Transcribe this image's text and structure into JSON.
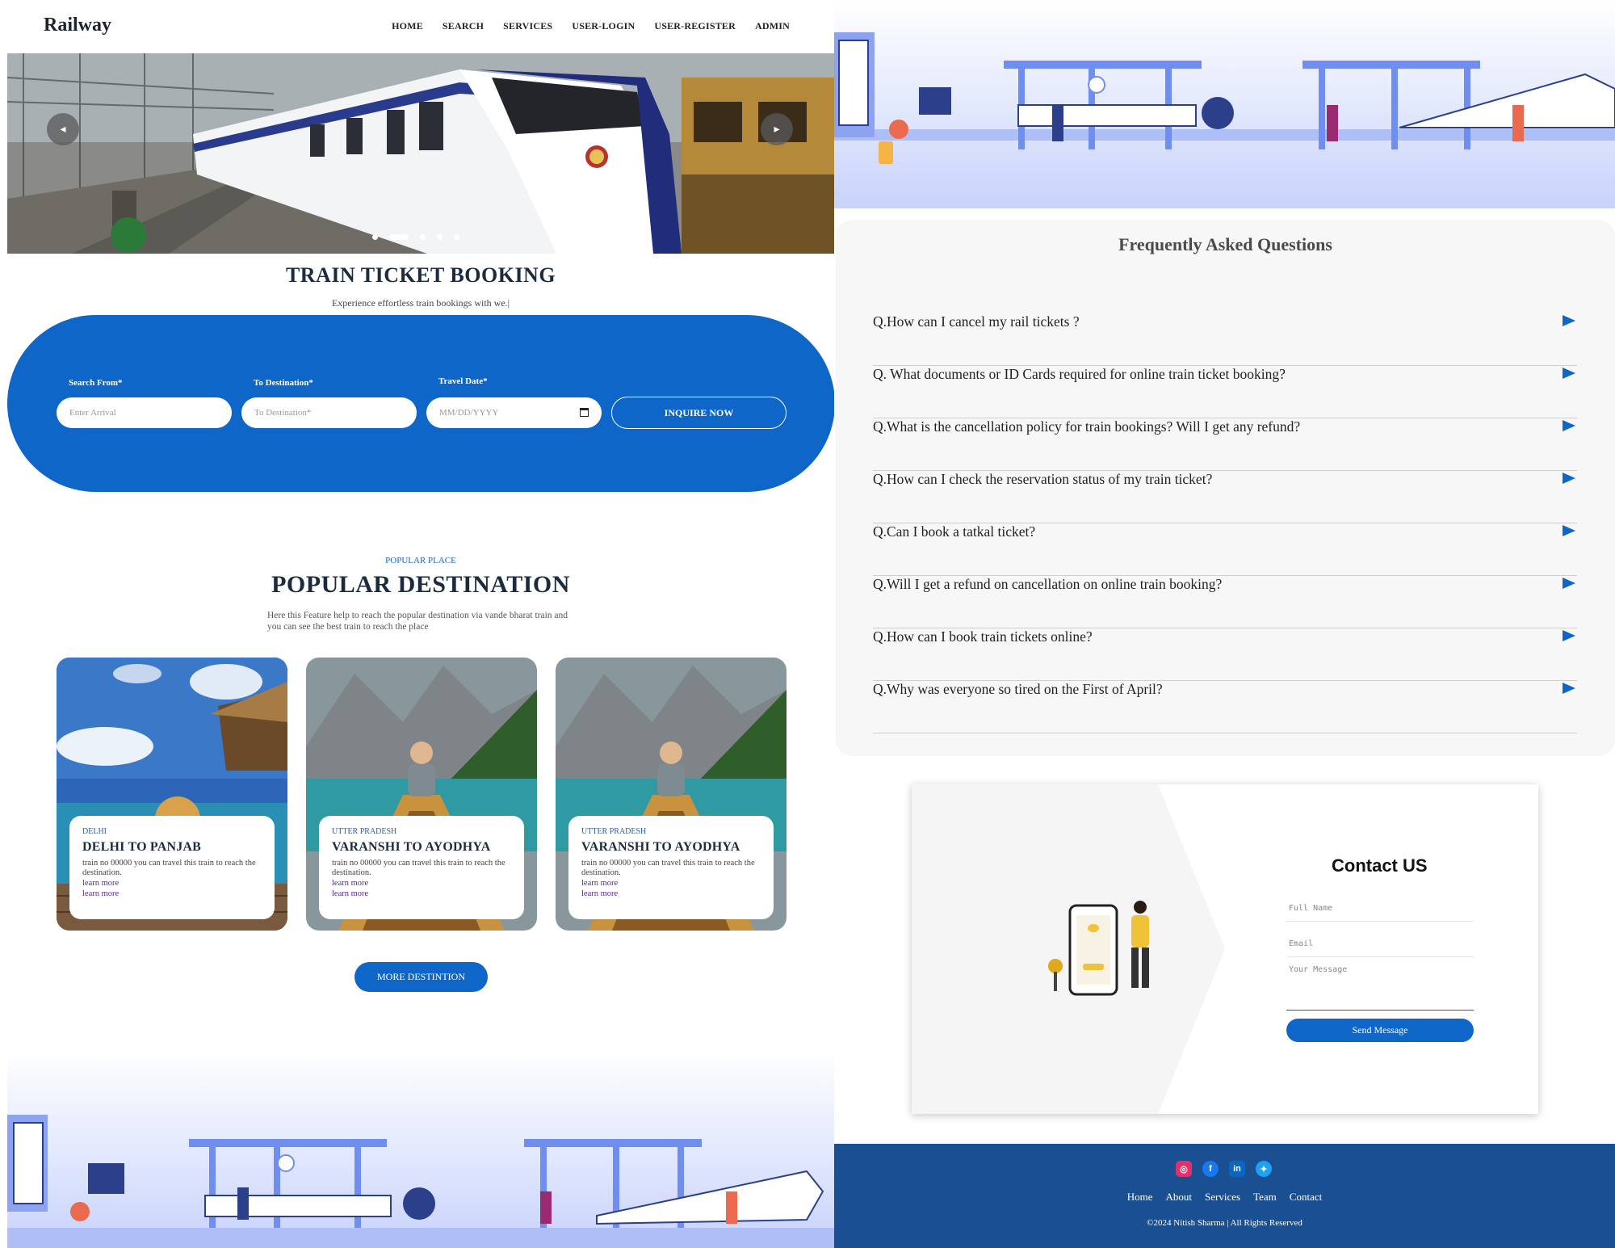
{
  "brand": "Railway",
  "nav": [
    "HOME",
    "SEARCH",
    "SERVICES",
    "USER-LOGIN",
    "USER-REGISTER",
    "ADMIN"
  ],
  "hero": {
    "prev": "◂",
    "next": "▸",
    "slides": 5,
    "active_slide": 2
  },
  "booking": {
    "title": "TRAIN TICKET BOOKING",
    "subtitle": "Experience effortless train bookings with we.|",
    "from_label": "Search From*",
    "from_placeholder": "Enter Arrival",
    "to_label": "To Destination*",
    "to_placeholder": "To Destination*",
    "date_label": "Travel Date*",
    "date_placeholder": "MM/DD/YYYY",
    "inquire": "INQUIRE NOW"
  },
  "popular": {
    "tag": "POPULAR PLACE",
    "title": "POPULAR DESTINATION",
    "description": "Here this Feature help to reach the popular destination via vande bharat train and you can see the best train to reach the place",
    "cards": [
      {
        "state": "DELHI",
        "title": "DELHI TO PANJAB",
        "text": "train no 00000 you can travel this train to reach the destination.",
        "link1": "learn more",
        "link2": "learn more"
      },
      {
        "state": "UTTER PRADESH",
        "title": "VARANSHI TO AYODHYA",
        "text": "train no 00000 you can travel this train to reach the destination.",
        "link1": "learn more",
        "link2": "learn more"
      },
      {
        "state": "UTTER PRADESH",
        "title": "VARANSHI TO AYODHYA",
        "text": "train no 00000 you can travel this train to reach the destination.",
        "link1": "learn more",
        "link2": "learn more"
      }
    ],
    "more": "MORE DESTINTION"
  },
  "faq": {
    "title": "Frequently Asked Questions",
    "items": [
      "Q.How can I cancel my rail tickets ?",
      "Q. What documents or ID Cards required for online train ticket booking?",
      "Q.What is the cancellation policy for train bookings? Will I get any refund?",
      "Q.How can I check the reservation status of my train ticket?",
      "Q.Can I book a tatkal ticket?",
      "Q.Will I get a refund on cancellation on online train booking?",
      "Q.How can I book train tickets online?",
      "Q.Why was everyone so tired on the First of April?"
    ]
  },
  "contact": {
    "title": "Contact US",
    "name_placeholder": "Full Name",
    "email_placeholder": "Email",
    "message_placeholder": "Your Message",
    "send": "Send Message"
  },
  "footer": {
    "socials": [
      {
        "name": "instagram-icon",
        "glyph": "◎",
        "color": "#e1306c"
      },
      {
        "name": "facebook-icon",
        "glyph": "f",
        "color": "#1877f2"
      },
      {
        "name": "linkedin-icon",
        "glyph": "in",
        "color": "#0a66c2"
      },
      {
        "name": "twitter-icon",
        "glyph": "✦",
        "color": "#1da1f2"
      }
    ],
    "links": [
      "Home",
      "About",
      "Services",
      "Team",
      "Contact"
    ],
    "copyright": "©2024 Nitish Sharma | All Rights Reserved"
  },
  "colors": {
    "accent": "#0e66c9",
    "footer": "#1a4f91",
    "faq_panel": "#f7f7f7",
    "heading": "#1c2c3e"
  }
}
